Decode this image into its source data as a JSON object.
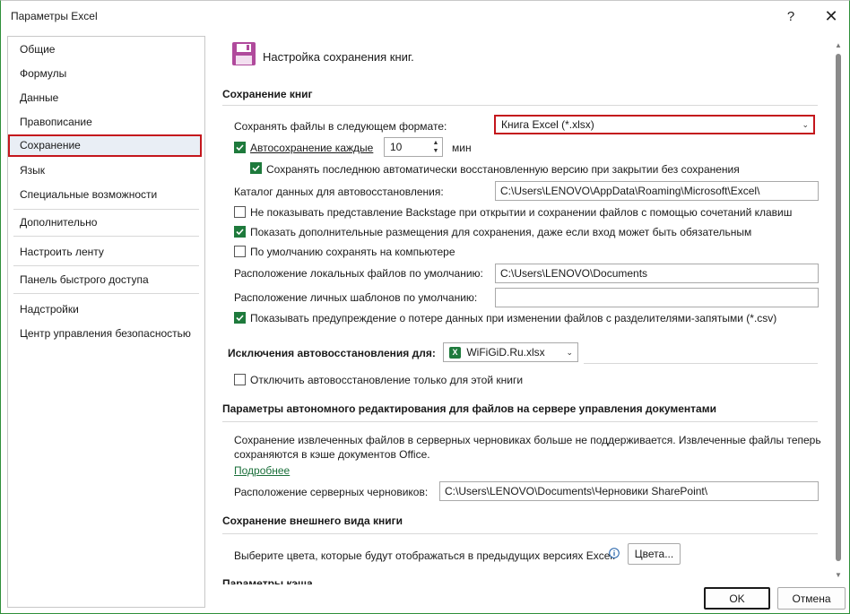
{
  "window": {
    "title": "Параметры Excel",
    "help_glyph": "?",
    "close_glyph": "✕"
  },
  "sidebar": {
    "items": [
      {
        "label": "Общие"
      },
      {
        "label": "Формулы"
      },
      {
        "label": "Данные"
      },
      {
        "label": "Правописание"
      },
      {
        "label": "Сохранение",
        "active": true
      },
      {
        "label": "Язык"
      },
      {
        "label": "Специальные возможности"
      },
      {
        "label": "Дополнительно"
      },
      {
        "label": "Настроить ленту"
      },
      {
        "label": "Панель быстрого доступа"
      },
      {
        "label": "Надстройки"
      },
      {
        "label": "Центр управления безопасностью"
      }
    ]
  },
  "header": {
    "icon": "floppy-disk-icon",
    "title": "Настройка сохранения книг."
  },
  "save_books": {
    "section_title": "Сохранение книг",
    "format_label": "Сохранять файлы в следующем формате:",
    "format_value": "Книга Excel (*.xlsx)",
    "autosave_label": "Автосохранение каждые",
    "autosave_checked": true,
    "autosave_minutes": "10",
    "autosave_unit": "мин",
    "keep_last_label": "Сохранять последнюю автоматически восстановленную версию при закрытии без сохранения",
    "keep_last_checked": true,
    "autorecover_dir_label": "Каталог данных для автовосстановления:",
    "autorecover_dir_value": "C:\\Users\\LENOVO\\AppData\\Roaming\\Microsoft\\Excel\\",
    "no_backstage_label": "Не показывать представление Backstage при открытии и сохранении файлов с помощью сочетаний клавиш",
    "no_backstage_checked": false,
    "show_extra_label": "Показать дополнительные размещения для сохранения, даже если вход может быть обязательным",
    "show_extra_checked": true,
    "save_local_label": "По умолчанию сохранять на компьютере",
    "save_local_checked": false,
    "local_files_label": "Расположение локальных файлов по умолчанию:",
    "local_files_value": "C:\\Users\\LENOVO\\Documents",
    "templates_label": "Расположение личных шаблонов по умолчанию:",
    "templates_value": "",
    "csv_warning_label": "Показывать предупреждение о потере данных при изменении файлов с разделителями-запятыми (*.csv)",
    "csv_warning_checked": true
  },
  "exceptions": {
    "label": "Исключения автовосстановления для:",
    "file_value": "WiFiGiD.Ru.xlsx",
    "file_icon": "excel-file-icon",
    "disable_label": "Отключить автовосстановление только для этой книги",
    "disable_checked": false
  },
  "offline": {
    "section_title": "Параметры автономного редактирования для файлов на сервере управления документами",
    "info_line1": "Сохранение извлеченных файлов в серверных черновиках больше не поддерживается. Извлеченные файлы теперь",
    "info_line2": "сохраняются в кэше документов Office.",
    "more_link": "Подробнее",
    "drafts_label": "Расположение серверных черновиков:",
    "drafts_value": "C:\\Users\\LENOVO\\Documents\\Черновики SharePoint\\"
  },
  "appearance": {
    "section_title": "Сохранение внешнего вида книги",
    "colors_label": "Выберите цвета, которые будут отображаться в предыдущих версиях Excel:",
    "info_icon": "info-icon",
    "colors_button": "Цвета...",
    "cutoff_text": "Параметры кэша"
  },
  "footer": {
    "ok_label": "OK",
    "cancel_label": "Отмена"
  },
  "colors": {
    "accent_green": "#1e7a3c",
    "highlight_red": "#c4161c"
  }
}
